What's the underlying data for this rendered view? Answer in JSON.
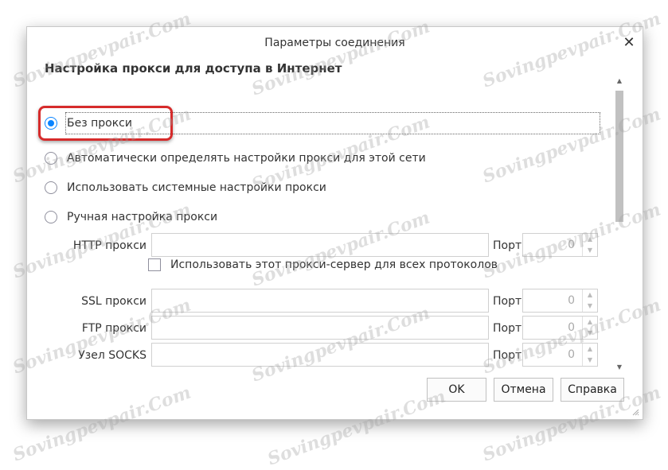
{
  "dialog": {
    "title": "Параметры соединения",
    "close_label": "✕",
    "section_title": "Настройка прокси для доступа в Интернет",
    "radio_options": [
      {
        "label": "Без прокси",
        "checked": true
      },
      {
        "label": "Автоматически определять настройки прокси для этой сети",
        "checked": false
      },
      {
        "label": "Использовать системные настройки прокси",
        "checked": false
      },
      {
        "label": "Ручная настройка прокси",
        "checked": false
      }
    ],
    "http_proxy_label": "HTTP прокси",
    "use_for_all_label": "Использовать этот прокси-сервер для всех протоколов",
    "ssl_proxy_label": "SSL прокси",
    "ftp_proxy_label": "FTP прокси",
    "socks_host_label": "Узел SOCKS",
    "port_label": "Порт",
    "ports": {
      "http": "0",
      "ssl": "0",
      "ftp": "0",
      "socks": "0"
    },
    "ok_label": "OK",
    "cancel_label": "Отмена",
    "help_label": "Справка"
  },
  "watermark_text": "Sovingpevpair.Com",
  "colors": {
    "accent": "#0a84ff",
    "highlight": "#d62b2b"
  }
}
